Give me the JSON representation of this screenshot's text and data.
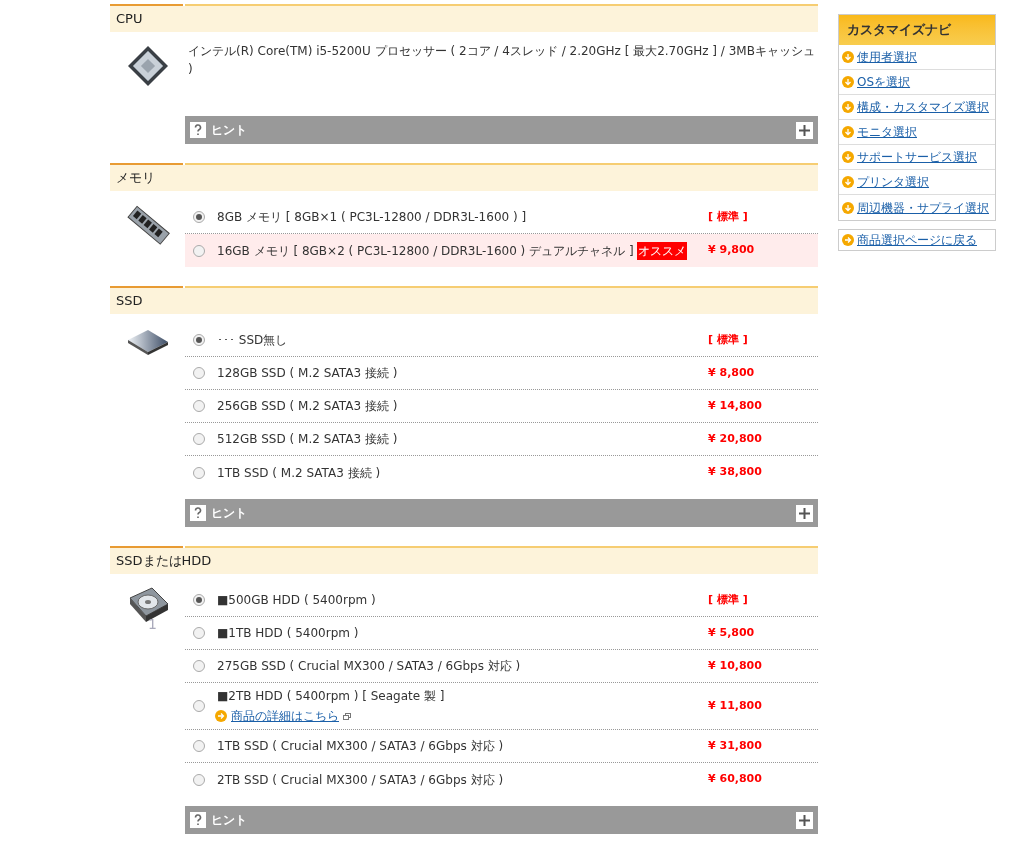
{
  "sections": [
    {
      "title": "CPU",
      "description": "インテル(R) Core(TM) i5-5200U プロセッサー ( 2コア / 4スレッド / 2.20GHz [ 最大2.70GHz ] / 3MBキャッシュ )",
      "hint": "ヒント"
    },
    {
      "title": "メモリ",
      "options": [
        {
          "label": "8GB メモリ [ 8GB×1 ( PC3L-12800 / DDR3L-1600 ) ]",
          "price": "[ 標準 ]",
          "selected": true,
          "highlighted": false
        },
        {
          "label": "16GB メモリ [ 8GB×2 ( PC3L-12800 / DDR3L-1600 ) デュアルチャネル ]",
          "badge": "オススメ",
          "price": "¥ 9,800",
          "selected": false,
          "highlighted": true
        }
      ]
    },
    {
      "title": "SSD",
      "options": [
        {
          "label": "･･･ SSD無し",
          "price": "[ 標準 ]",
          "selected": true,
          "highlighted": false
        },
        {
          "label": "128GB SSD ( M.2 SATA3 接続 )",
          "price": "¥ 8,800",
          "selected": false,
          "highlighted": false
        },
        {
          "label": "256GB SSD ( M.2 SATA3 接続 )",
          "price": "¥ 14,800",
          "selected": false,
          "highlighted": false
        },
        {
          "label": "512GB SSD ( M.2 SATA3 接続 )",
          "price": "¥ 20,800",
          "selected": false,
          "highlighted": false
        },
        {
          "label": "1TB SSD ( M.2 SATA3 接続 )",
          "price": "¥ 38,800",
          "selected": false,
          "highlighted": false
        }
      ],
      "hint": "ヒント"
    },
    {
      "title": "SSDまたはHDD",
      "icon_caption": "1",
      "options": [
        {
          "label": "■500GB HDD ( 5400rpm )",
          "price": "[ 標準 ]",
          "selected": true,
          "highlighted": false
        },
        {
          "label": "■1TB HDD ( 5400rpm )",
          "price": "¥ 5,800",
          "selected": false,
          "highlighted": false
        },
        {
          "label": "275GB SSD ( Crucial MX300 / SATA3 / 6Gbps 対応 )",
          "price": "¥ 10,800",
          "selected": false,
          "highlighted": false
        },
        {
          "label": "■2TB HDD ( 5400rpm ) [ Seagate 製 ]",
          "link": "商品の詳細はこちら",
          "price": "¥ 11,800",
          "selected": false,
          "highlighted": false
        },
        {
          "label": "1TB SSD ( Crucial MX300 / SATA3 / 6Gbps 対応 )",
          "price": "¥ 31,800",
          "selected": false,
          "highlighted": false
        },
        {
          "label": "2TB SSD ( Crucial MX300 / SATA3 / 6Gbps 対応 )",
          "price": "¥ 60,800",
          "selected": false,
          "highlighted": false
        }
      ],
      "hint": "ヒント"
    }
  ],
  "sidebar": {
    "title": "カスタマイズナビ",
    "items": [
      "使用者選択",
      "OSを選択",
      "構成・カスタマイズ選択",
      "モニタ選択",
      "サポートサービス選択",
      "プリンタ選択",
      "周辺機器・サプライ選択"
    ],
    "back_link": "商品選択ページに戻る"
  }
}
